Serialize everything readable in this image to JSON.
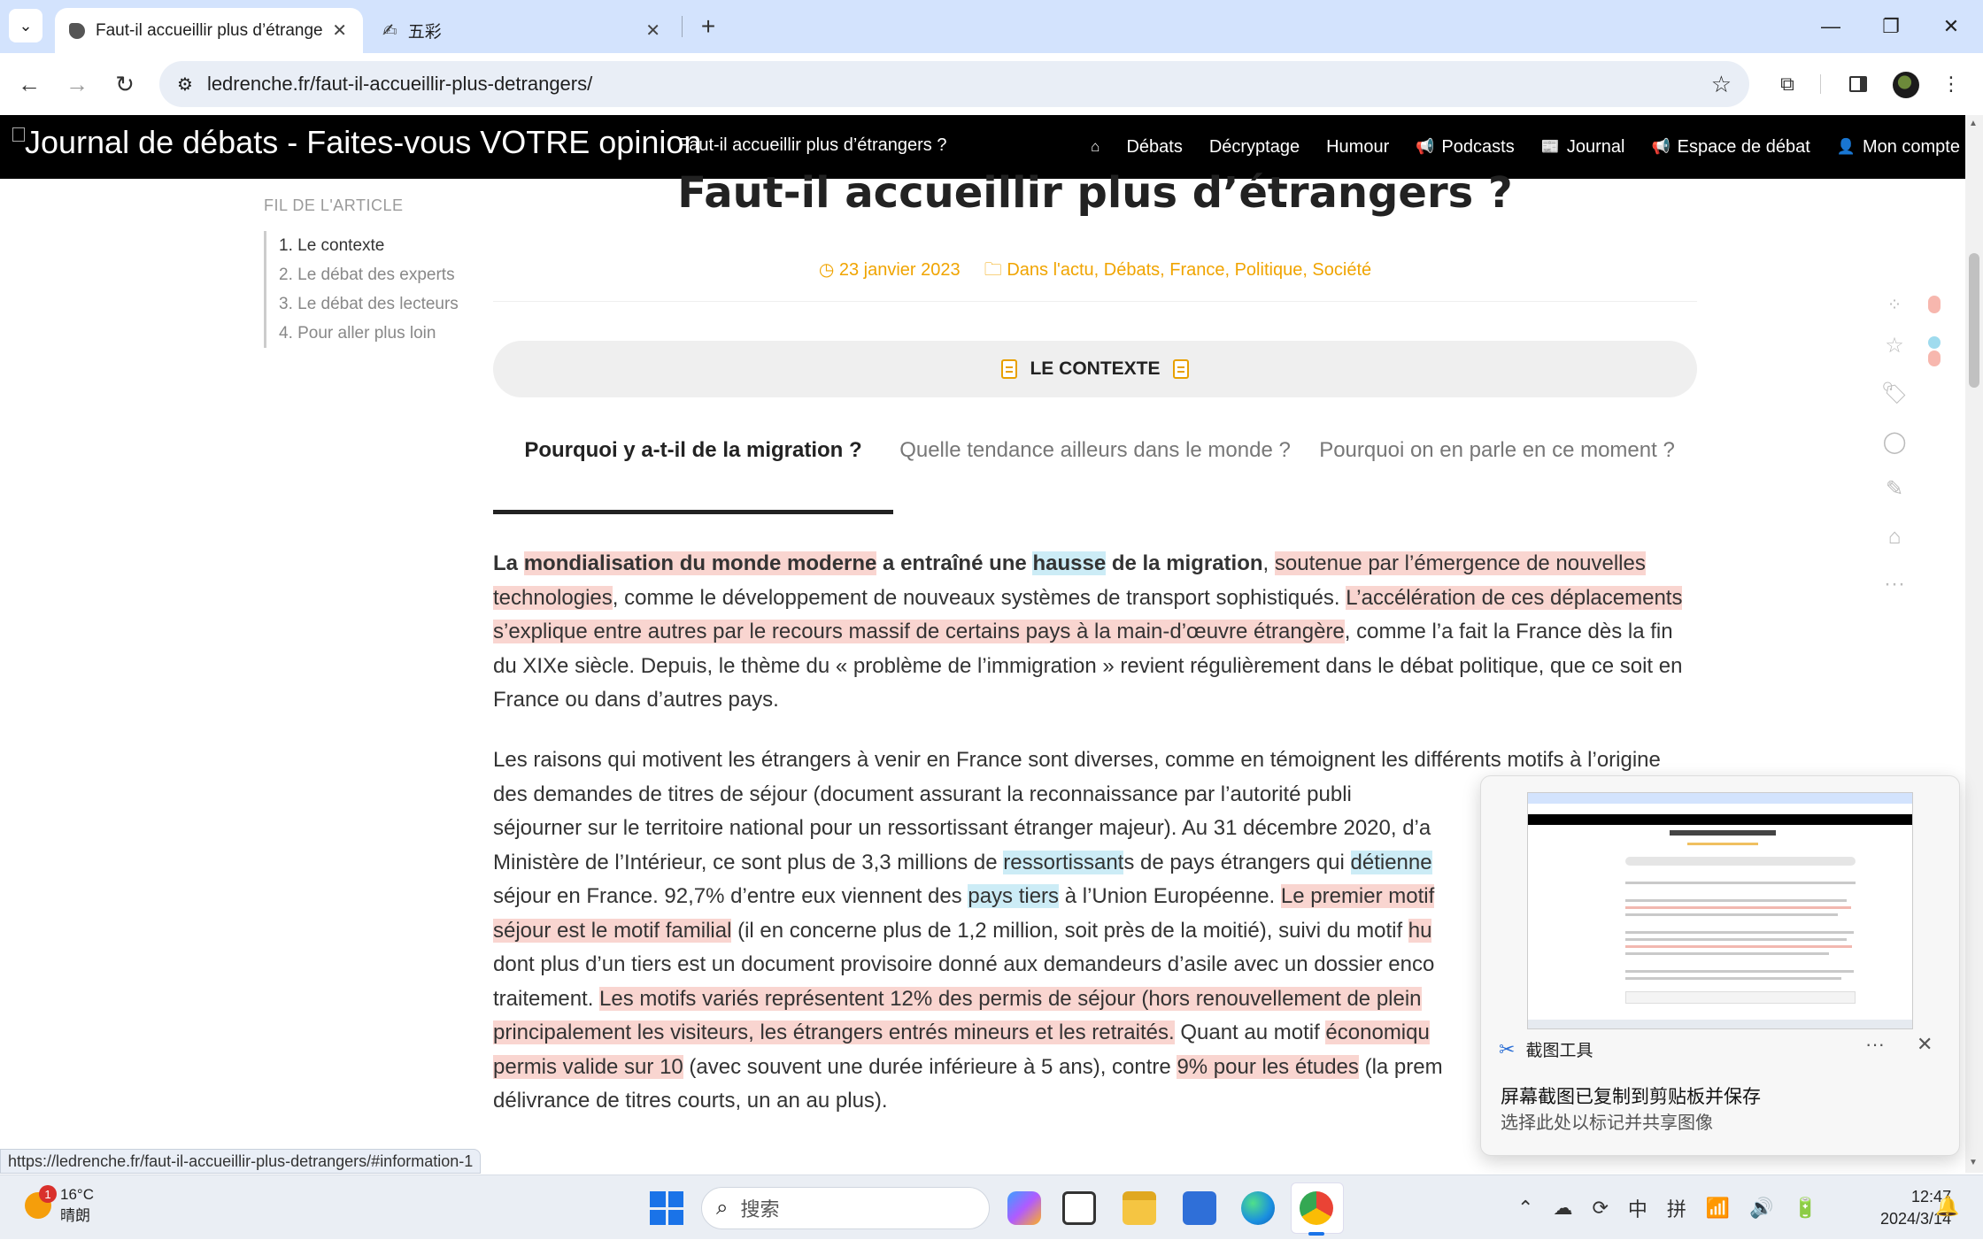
{
  "browser": {
    "tabs": [
      {
        "title": "Faut-il accueillir plus d’étrangers ?",
        "active": true
      },
      {
        "title": "五彩",
        "active": false
      }
    ],
    "new_tab_glyph": "+",
    "url": "ledrenche.fr/faut-il-accueillir-plus-detrangers/",
    "status_url": "https://ledrenche.fr/faut-il-accueillir-plus-detrangers/#information-1"
  },
  "site": {
    "logo_text": "Journal de débats - Faites-vous VOTRE opinion",
    "nav_title": "Faut-il accueillir plus d’étrangers ?",
    "menu": [
      {
        "label": "Débats",
        "icon": "home-icon"
      },
      {
        "label": "Décryptage"
      },
      {
        "label": "Humour"
      },
      {
        "label": "Podcasts",
        "icon": "megaphone-icon"
      },
      {
        "label": "Journal",
        "icon": "newspaper-icon"
      },
      {
        "label": "Espace de débat",
        "icon": "megaphone-icon"
      },
      {
        "label": "Mon compte",
        "icon": "user-icon"
      }
    ]
  },
  "toc": {
    "title": "FIL DE L'ARTICLE",
    "items": [
      "1. Le contexte",
      "2. Le débat des experts",
      "3. Le débat des lecteurs",
      "4. Pour aller plus loin"
    ]
  },
  "article": {
    "title": "Faut-il accueillir plus d’étrangers ?",
    "date": "23 janvier 2023",
    "categories": "Dans l'actu, Débats, France, Politique, Société",
    "section_label": "LE CONTEXTE",
    "tabs": [
      "Pourquoi y a-t-il de la migration ?",
      "Quelle tendance ailleurs dans le monde ?",
      "Pourquoi on en parle en ce moment ?"
    ],
    "p1": {
      "s1": "La ",
      "s2": "mondialisation du monde moderne",
      "s3": " a entraîné une ",
      "s4": "hausse",
      "s5": " de la migration",
      "s6": ", ",
      "s7": "soutenue par l’émergence de nouvelles technologies",
      "s8": ", comme le développement de nouveaux systèmes de transport sophistiqués. ",
      "s9": "L’accélération de ces déplacements s’explique entre autres par le recours massif de certains pays à la main-d’œuvre étrangère",
      "s10": ", comme l’a fait la France dès la fin du XIXe siècle. Depuis, le thème du « problème de l’immigration » revient régulièrement dans le débat politique, que ce soit en France ou dans d’autres pays."
    },
    "p2": {
      "s1": "Les raisons qui motivent les étrangers à venir en France sont diverses, comme en témoignent les différents motifs à l’origine des demandes de titres de séjour (document assurant la reconnaissance par l’autorité publi",
      "s2": "séjourner sur le territoire national pour un ressortissant étranger majeur). Au 31 décembre 2020, d’a",
      "s3": "Ministère de l’Intérieur, ce sont plus de 3,3 millions de ",
      "s4": "ressortissant",
      "s5": "s de pays étrangers qui ",
      "s6": "détienne",
      "s7": "séjour en France. 92,7% d’entre eux viennent des ",
      "s8": "pays tiers",
      "s9": " à l’Union Européenne. ",
      "s10": "Le premier motif",
      "s11": "séjour est le motif familial",
      "s12": " (il en concerne plus de 1,2 million, soit près de la moitié), suivi du motif ",
      "s13": "hu",
      "s14": "dont plus d’un tiers est un document provisoire donné aux demandeurs d’asile avec un dossier enco",
      "s15": "traitement. ",
      "s16": "Les motifs variés représentent 12% des permis de séjour (hors renouvellement de plein",
      "s17": "principalement les visiteurs, les étrangers entrés mineurs et les retraités.",
      "s18": " Quant au motif ",
      "s19": "économiqu",
      "s20": "permis valide sur 10",
      "s21": " (avec souvent une durée inférieure à 5 ans), contre ",
      "s22": "9% pour les études",
      "s23": " (la prem",
      "s24": "délivrance de titres courts, un an au plus)."
    }
  },
  "snip_toast": {
    "app_name": "截图工具",
    "more": "···",
    "close": "✕",
    "message": "屏幕截图已复制到剪贴板并保存",
    "subtext": "选择此处以标记并共享图像"
  },
  "taskbar": {
    "weather_badge": "1",
    "temperature": "16°C",
    "condition": "晴朗",
    "search_placeholder": "搜索",
    "ime_mode": "中",
    "ime_name": "拼",
    "time": "12:47",
    "date": "2024/3/14"
  },
  "colors": {
    "accent_orange": "#f0a400",
    "highlight_red": "#f9d5d0",
    "highlight_blue": "#ccecf6",
    "nav_bg": "#000000"
  }
}
